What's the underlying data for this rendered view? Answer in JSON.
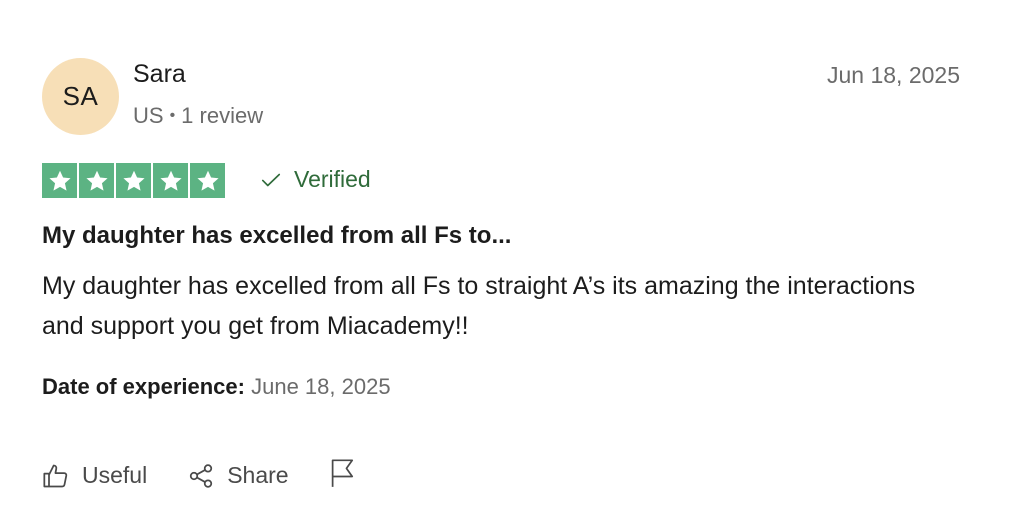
{
  "reviewer": {
    "initials": "SA",
    "name": "Sara",
    "country": "US",
    "separator": "•",
    "review_count": "1 review"
  },
  "review": {
    "date": "Jun 18, 2025",
    "rating": 5,
    "rating_max": 5,
    "verified_label": "Verified",
    "title": "My daughter has excelled from all Fs to...",
    "body": "My daughter has excelled from all Fs to straight A’s its amazing the interactions and support you get from Miacademy!!",
    "experience_label": "Date of experience:",
    "experience_date": "June 18, 2025"
  },
  "actions": {
    "useful_label": "Useful",
    "share_label": "Share"
  },
  "colors": {
    "star_bg": "#5cb383",
    "avatar_bg": "#f7dfb7",
    "verified_text": "#2f6b3a"
  },
  "icons": [
    "star-icon",
    "checkmark-icon",
    "thumbs-up-icon",
    "share-icon",
    "flag-icon"
  ]
}
